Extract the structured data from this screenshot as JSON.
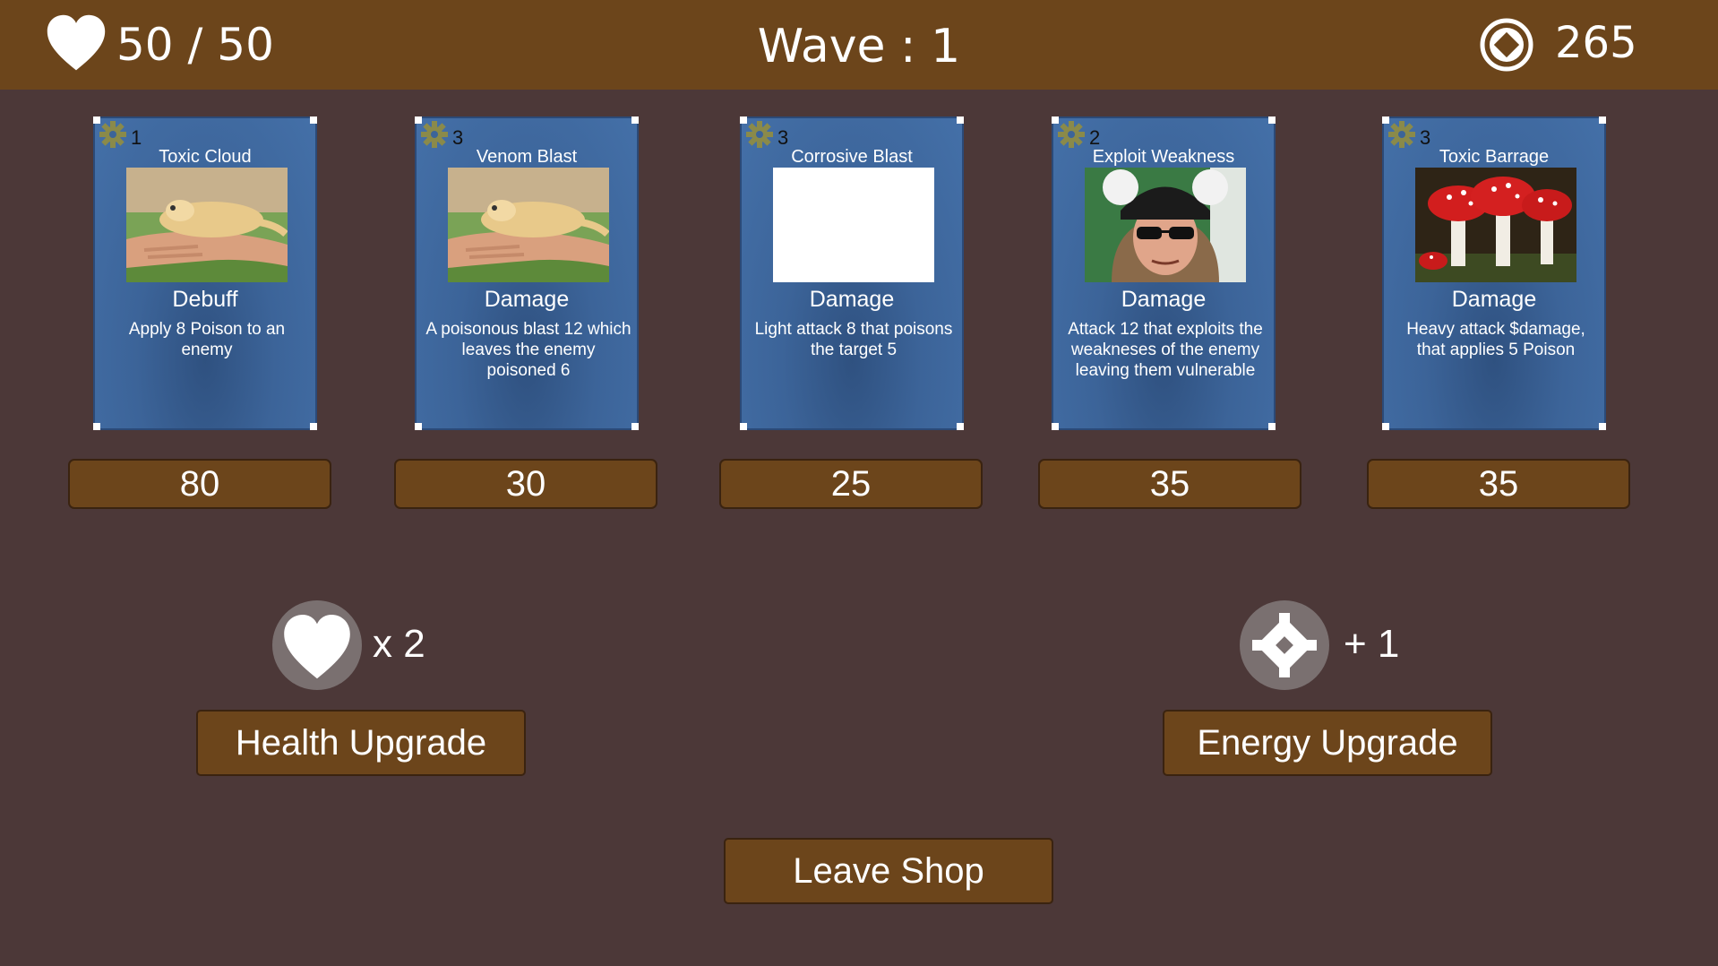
{
  "hud": {
    "health_text": "50 / 50",
    "wave_text": "Wave : 1",
    "gold_text": "265"
  },
  "cards": [
    {
      "cost": "1",
      "name": "Toxic Cloud",
      "type": "Debuff",
      "description": "Apply 8 Poison to an enemy",
      "art": "hand-holding-lizard"
    },
    {
      "cost": "3",
      "name": "Venom Blast",
      "type": "Damage",
      "description": "A poisonous blast 12 which leaves the enemy poisoned 6",
      "art": "hand-holding-lizard"
    },
    {
      "cost": "3",
      "name": "Corrosive Blast",
      "type": "Damage",
      "description": "Light attack 8 that poisons the target 5",
      "art": "blank"
    },
    {
      "cost": "2",
      "name": "Exploit Weakness",
      "type": "Damage",
      "description": "Attack 12 that exploits the weakneses of the enemy leaving them vulnerable",
      "art": "person-with-sunglasses"
    },
    {
      "cost": "3",
      "name": "Toxic Barrage",
      "type": "Damage",
      "description": "Heavy attack $damage, that applies 5 Poison",
      "art": "red-mushrooms"
    }
  ],
  "prices": [
    "80",
    "30",
    "25",
    "35",
    "35"
  ],
  "health_upgrade": {
    "amount": "x 2",
    "button_label": "Health Upgrade",
    "icon": "heart-icon"
  },
  "energy_upgrade": {
    "amount": "+ 1",
    "button_label": "Energy Upgrade",
    "icon": "energy-icon"
  },
  "leave_label": "Leave Shop",
  "colors": {
    "background": "#4c3838",
    "bar": "#6c451b",
    "card": "#3c6499",
    "button": "#6c451b"
  }
}
